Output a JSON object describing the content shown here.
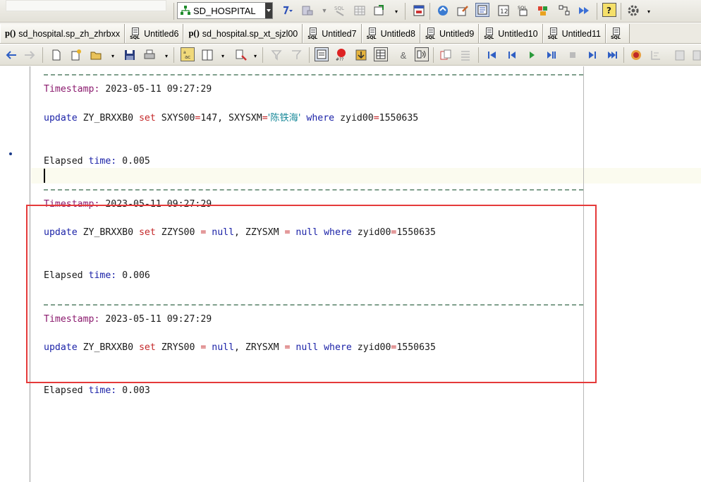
{
  "toolbar": {
    "database": "SD_HOSPITAL",
    "icons": [
      "database-icon",
      "compile-icon",
      "tools-icon",
      "sql-icon",
      "table-icon",
      "export-icon",
      "window-icon",
      "refresh-icon",
      "edit-icon",
      "report-icon",
      "panel-icon",
      "sql-window-icon",
      "package-icon",
      "diagram-icon",
      "forward-icon",
      "help-icon",
      "settings-icon"
    ]
  },
  "tabs": [
    {
      "icon": "procedure-icon",
      "prefix": "p()",
      "label": "sd_hospital.sp_zh_zhrbxx"
    },
    {
      "icon": "sql-icon",
      "label": "Untitled6"
    },
    {
      "icon": "procedure-icon",
      "prefix": "p()",
      "label": "sd_hospital.sp_xt_sjzl00"
    },
    {
      "icon": "sql-icon",
      "label": "Untitled7"
    },
    {
      "icon": "sql-icon",
      "label": "Untitled8"
    },
    {
      "icon": "sql-icon",
      "label": "Untitled9"
    },
    {
      "icon": "sql-icon",
      "label": "Untitled10"
    },
    {
      "icon": "sql-icon",
      "label": "Untitled11"
    },
    {
      "icon": "sql-icon",
      "label": ""
    }
  ],
  "output": {
    "entries": [
      {
        "timestamp_label": "Timestamp:",
        "timestamp": "2023-05-11 09:27:29",
        "sql": {
          "k1": "update",
          "t1": " ZY_BRXXB0 ",
          "k2": "set",
          "t2": " SXYS00",
          "o1": "=",
          "t3": "147, SXYSXM",
          "o2": "=",
          "s1": "'陈铁海'",
          "t4": " ",
          "k3": "where",
          "t5": " zyid00",
          "o3": "=",
          "t6": "1550635"
        },
        "elapsed_label": "Elapsed",
        "time_label": "time:",
        "elapsed": " 0.005"
      },
      {
        "timestamp_label": "Timestamp:",
        "timestamp": "2023-05-11 09:27:29",
        "sql": {
          "k1": "update",
          "t1": " ZY_BRXXB0 ",
          "k2": "set",
          "t2": " ZZYS00 ",
          "o1": "=",
          "k4": "null",
          "t3": ", ZZYSXM ",
          "o2": "=",
          "k5": "null",
          "t4": " ",
          "k3": "where",
          "t5": " zyid00",
          "o3": "=",
          "t6": "1550635"
        },
        "elapsed_label": "Elapsed",
        "time_label": "time:",
        "elapsed": " 0.006"
      },
      {
        "timestamp_label": "Timestamp:",
        "timestamp": "2023-05-11 09:27:29",
        "sql": {
          "k1": "update",
          "t1": " ZY_BRXXB0 ",
          "k2": "set",
          "t2": " ZRYS00 ",
          "o1": "=",
          "k4": "null",
          "t3": ", ZRYSXM ",
          "o2": "=",
          "k5": "null",
          "t4": " ",
          "k3": "where",
          "t5": " zyid00",
          "o3": "=",
          "t6": "1550635"
        },
        "elapsed_label": "Elapsed",
        "time_label": "time:",
        "elapsed": " 0.003"
      }
    ]
  },
  "colors": {
    "keyword": "#1c23a8",
    "operator": "#c4282a",
    "timestamp_label": "#8b1a6e",
    "string": "#1a8a9a",
    "highlight_box": "#e53a3a"
  }
}
